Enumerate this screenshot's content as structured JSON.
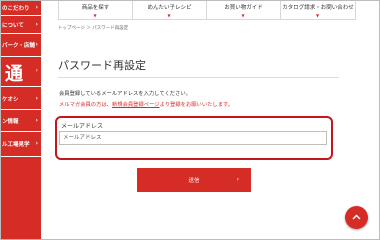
{
  "sidebar": {
    "items": [
      {
        "label": "のこだわり"
      },
      {
        "label": "について"
      },
      {
        "label": "パーク・店舗"
      },
      {
        "label": "通"
      },
      {
        "label": "ケオシ"
      },
      {
        "label": "ン情報"
      },
      {
        "label": "ル工場見学"
      }
    ]
  },
  "topnav": {
    "tabs": [
      {
        "label": "商品を探す"
      },
      {
        "label": "めんたい子レシピ"
      },
      {
        "label": "お買い物ガイド"
      },
      {
        "label": "カタログ請求・お問い合わせ"
      }
    ]
  },
  "breadcrumb": "トップページ ＞ パスワード再設定",
  "page_title": "パスワード再設定",
  "info_text": "会員登録しているメールアドレスを入力してください。",
  "notice": {
    "prefix": "メルマガ会員の方は、",
    "link": "新規会員登録ページ",
    "suffix": "より登録をお願いいたします。"
  },
  "form": {
    "email_label": "メールアドレス",
    "email_placeholder": "メールアドレス",
    "submit_label": "送信"
  },
  "colors": {
    "brand_red": "#d52c26",
    "highlight_red": "#c4161c"
  }
}
